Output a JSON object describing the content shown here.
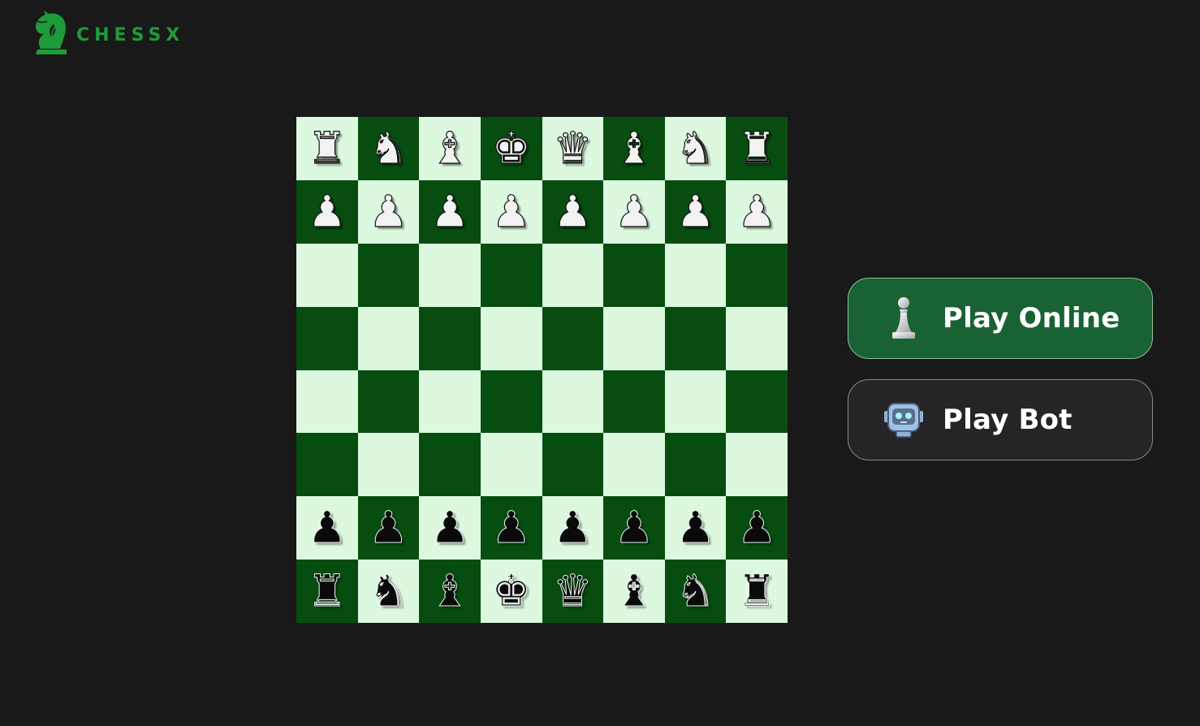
{
  "brand": {
    "name": "CHESSX",
    "icon": "knight-logo-icon",
    "color": "#1e9b3b"
  },
  "board": {
    "light_color": "#dcf9e0",
    "dark_color": "#074d10",
    "rows": [
      [
        "♜",
        "♞",
        "♝",
        "♚",
        "♛",
        "♝",
        "♞",
        "♜"
      ],
      [
        "♟",
        "♟",
        "♟",
        "♟",
        "♟",
        "♟",
        "♟",
        "♟"
      ],
      [
        "",
        "",
        "",
        "",
        "",
        "",
        "",
        ""
      ],
      [
        "",
        "",
        "",
        "",
        "",
        "",
        "",
        ""
      ],
      [
        "",
        "",
        "",
        "",
        "",
        "",
        "",
        ""
      ],
      [
        "",
        "",
        "",
        "",
        "",
        "",
        "",
        ""
      ],
      [
        "♟",
        "♟",
        "♟",
        "♟",
        "♟",
        "♟",
        "♟",
        "♟"
      ],
      [
        "♜",
        "♞",
        "♝",
        "♚",
        "♛",
        "♝",
        "♞",
        "♜"
      ]
    ],
    "row_colors": [
      "white",
      "white",
      "",
      "",
      "",
      "",
      "black",
      "black"
    ]
  },
  "actions": {
    "play_online": {
      "label": "Play Online",
      "icon": "pawn-icon",
      "bg": "#186234"
    },
    "play_bot": {
      "label": "Play Bot",
      "icon": "robot-icon",
      "bg": "#252528"
    }
  }
}
